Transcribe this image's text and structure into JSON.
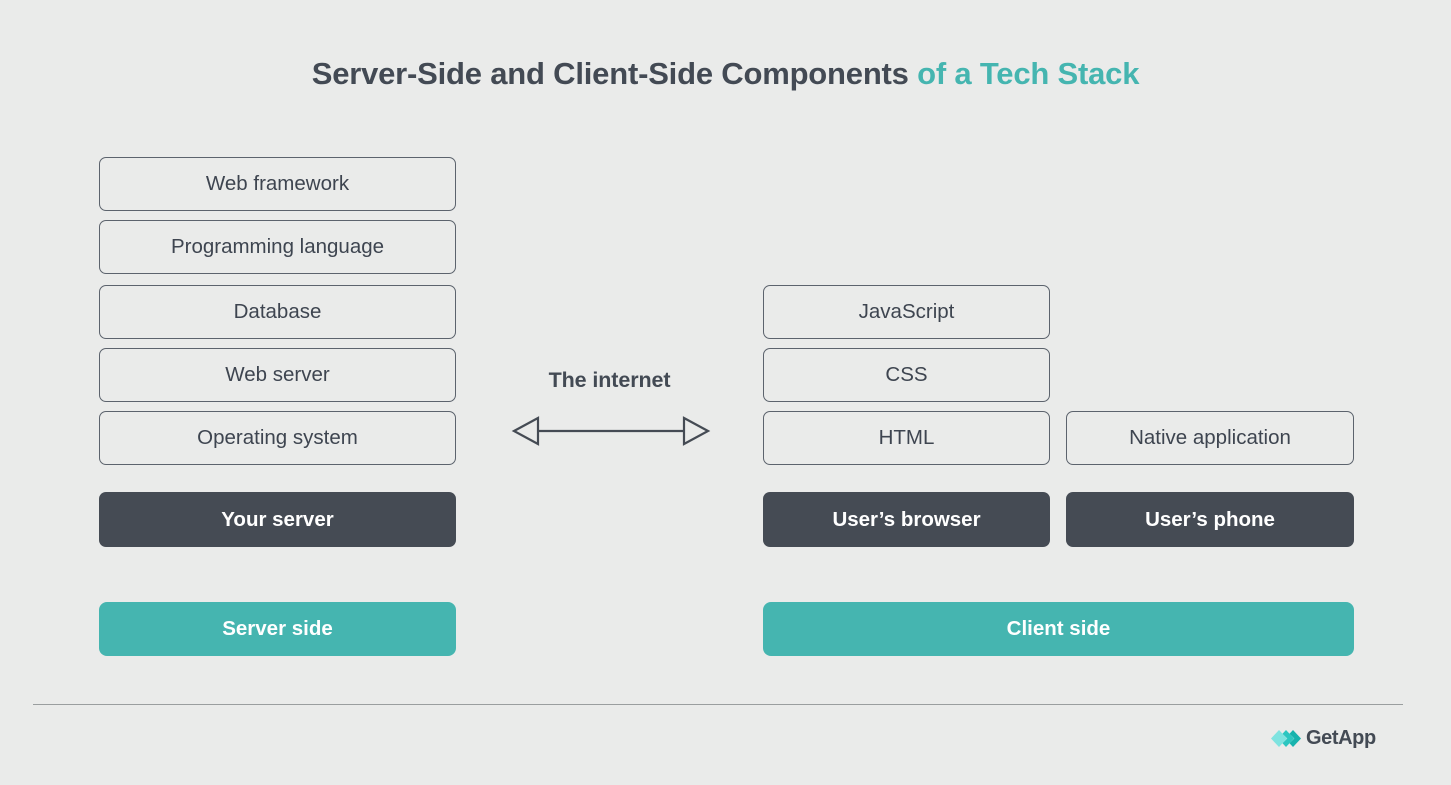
{
  "title": {
    "primary": "Server-Side and Client-Side Components",
    "accent": " of a Tech Stack"
  },
  "colors": {
    "background": "#eaebea",
    "dark_slate": "#454b54",
    "teal": "#45b5b0",
    "outline_border": "#5c636d",
    "body_text": "#3e4550",
    "divider": "#9a9e9f",
    "logo_cyan": "#7fe3e0",
    "logo_teal": "#17b3ad"
  },
  "server_side": {
    "layers": [
      {
        "label": "Web framework"
      },
      {
        "label": "Programming language"
      },
      {
        "label": "Database"
      },
      {
        "label": "Web server"
      },
      {
        "label": "Operating system"
      }
    ],
    "owner": "Your server",
    "side_label": "Server side"
  },
  "internet": {
    "label": "The internet",
    "arrow_icon": "double-headed-arrow"
  },
  "client_side": {
    "browser_layers": [
      {
        "label": "JavaScript"
      },
      {
        "label": "CSS"
      },
      {
        "label": "HTML"
      }
    ],
    "phone_layers": [
      {
        "label": "Native application"
      }
    ],
    "browser_owner": "User’s browser",
    "phone_owner": "User’s phone",
    "side_label": "Client side"
  },
  "footer": {
    "brand": "GetApp",
    "logo_icon": "getapp-chevron-logo"
  }
}
